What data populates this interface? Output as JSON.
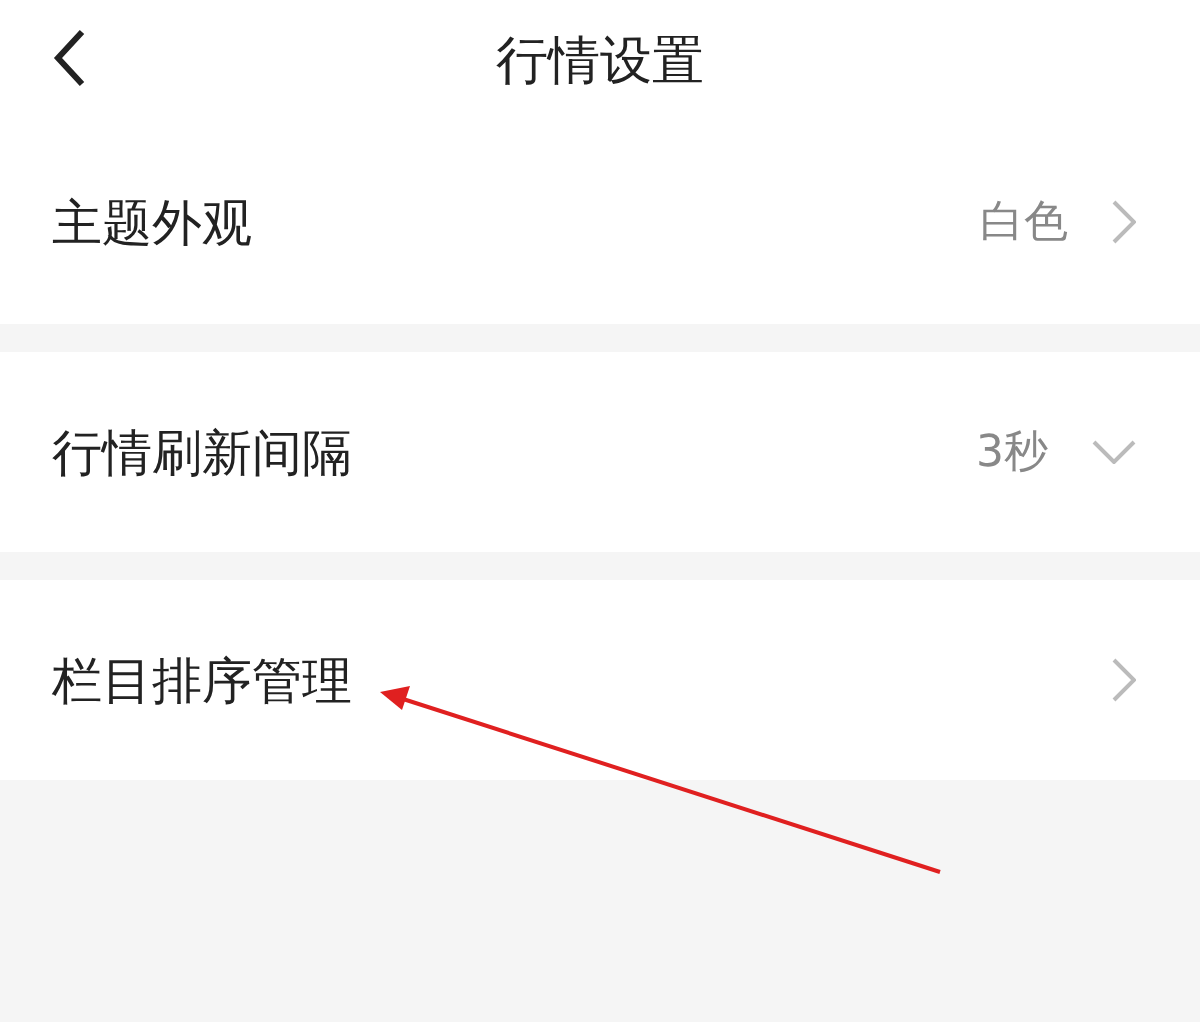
{
  "header": {
    "title": "行情设置"
  },
  "settings": [
    {
      "label": "主题外观",
      "value": "白色",
      "kind": "link"
    },
    {
      "label": "行情刷新间隔",
      "value": "3秒",
      "kind": "dropdown"
    },
    {
      "label": "栏目排序管理",
      "kind": "link"
    }
  ]
}
